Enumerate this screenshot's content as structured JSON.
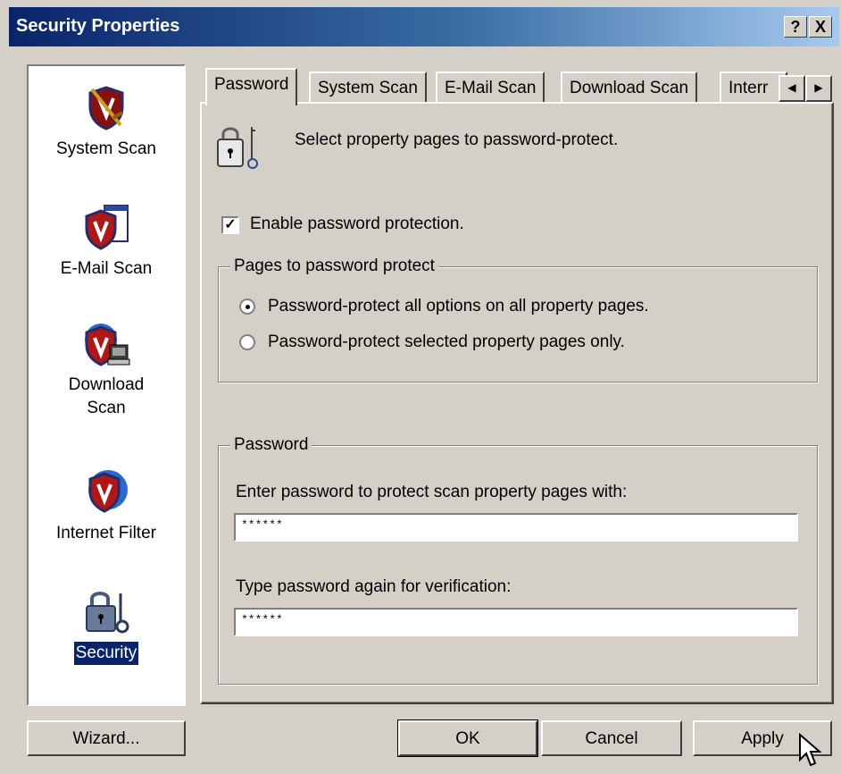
{
  "window": {
    "title": "Security Properties",
    "help_button": "?",
    "close_button": "X"
  },
  "sidebar": {
    "items": [
      {
        "label": "System Scan",
        "icon": "shield-sword-icon"
      },
      {
        "label": "E-Mail Scan",
        "icon": "shield-mail-icon"
      },
      {
        "label": "Download Scan",
        "icon": "shield-computer-icon",
        "label_line1": "Download",
        "label_line2": "Scan"
      },
      {
        "label": "Internet Filter",
        "icon": "shield-globe-icon"
      },
      {
        "label": "Security",
        "icon": "padlock-key-icon",
        "selected": true
      }
    ]
  },
  "tabs": [
    {
      "label": "Password",
      "active": true
    },
    {
      "label": "System Scan"
    },
    {
      "label": "E-Mail Scan"
    },
    {
      "label": "Download Scan"
    },
    {
      "label": "Interr"
    }
  ],
  "password_page": {
    "header_text": "Select property pages to password-protect.",
    "enable_checkbox": {
      "label": "Enable password protection.",
      "checked": true
    },
    "pages_group": {
      "title": "Pages to password protect",
      "options": [
        {
          "label": "Password-protect all options on all property pages.",
          "selected": true
        },
        {
          "label": "Password-protect selected property pages only.",
          "selected": false
        }
      ]
    },
    "password_group": {
      "title": "Password",
      "enter_label": "Enter password to protect scan property pages with:",
      "enter_value": "******",
      "verify_label": "Type password again for verification:",
      "verify_value": "******"
    }
  },
  "buttons": {
    "wizard": "Wizard...",
    "ok": "OK",
    "cancel": "Cancel",
    "apply": "Apply"
  },
  "colors": {
    "face": "#d4d0c8",
    "title_start": "#0a246a",
    "title_end": "#a6caf0",
    "selection": "#0a246a"
  }
}
